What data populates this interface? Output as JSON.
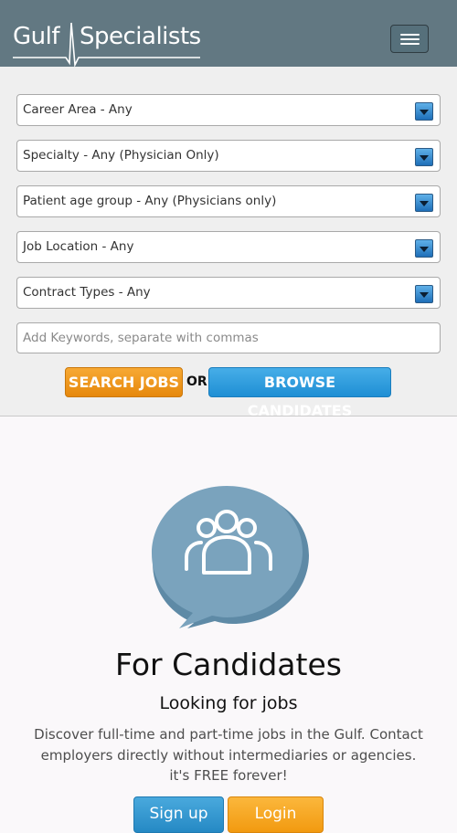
{
  "header": {
    "logo_word1": "Gulf",
    "logo_word2": "Specialists",
    "menu_icon": "hamburger-menu-icon",
    "background_color": "#627882"
  },
  "search": {
    "filters": [
      "Career Area - Any",
      "Specialty - Any (Physician Only)",
      "Patient age group - Any (Physicians only)",
      "Job Location - Any",
      "Contract Types - Any"
    ],
    "keywords_placeholder": "Add Keywords, separate with commas",
    "search_button": "SEARCH JOBS",
    "or_text": "OR",
    "browse_button": "BROWSE CANDIDATES",
    "search_button_color": "#f39c1f",
    "browse_button_color": "#2b9ee0"
  },
  "candidates": {
    "icon": "people-group-speech-bubble-icon",
    "title": "For Candidates",
    "subtitle": "Looking for jobs",
    "description": "Discover full-time and part-time jobs in the Gulf. Contact employers directly without intermediaries or agencies. it's FREE forever!",
    "signup_button": "Sign up",
    "login_button": "Login"
  }
}
